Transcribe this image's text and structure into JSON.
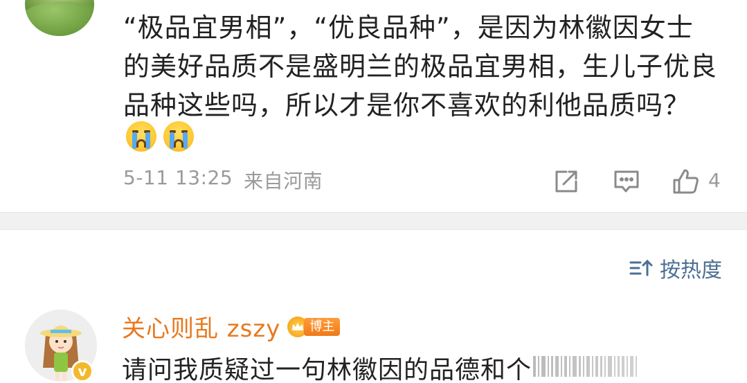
{
  "top_comment": {
    "lines": [
      "“极品宜男相”，“优良品种”，是因为林徽因女士",
      "的美好品质不是盛明兰的极品宜男相，生儿子优良",
      "品种这些吗，所以才是你不喜欢的利他品质吗？"
    ],
    "emojis": [
      "crying-emoji",
      "crying-emoji"
    ],
    "time": "5-11 13:25",
    "location": "来自河南",
    "like_count": "4"
  },
  "sort": {
    "label": "按热度"
  },
  "bottom_comment": {
    "username": "关心则乱 zszy",
    "badge_label": "博主",
    "verified_mark": "v",
    "text": "请问我质疑过一句林徽因的品德和个"
  },
  "colors": {
    "username": "#e8791e",
    "meta": "#9a9a9a",
    "sort_link": "#4b6f93",
    "divider": "#f1f1f1",
    "badge": "#f07a18"
  }
}
